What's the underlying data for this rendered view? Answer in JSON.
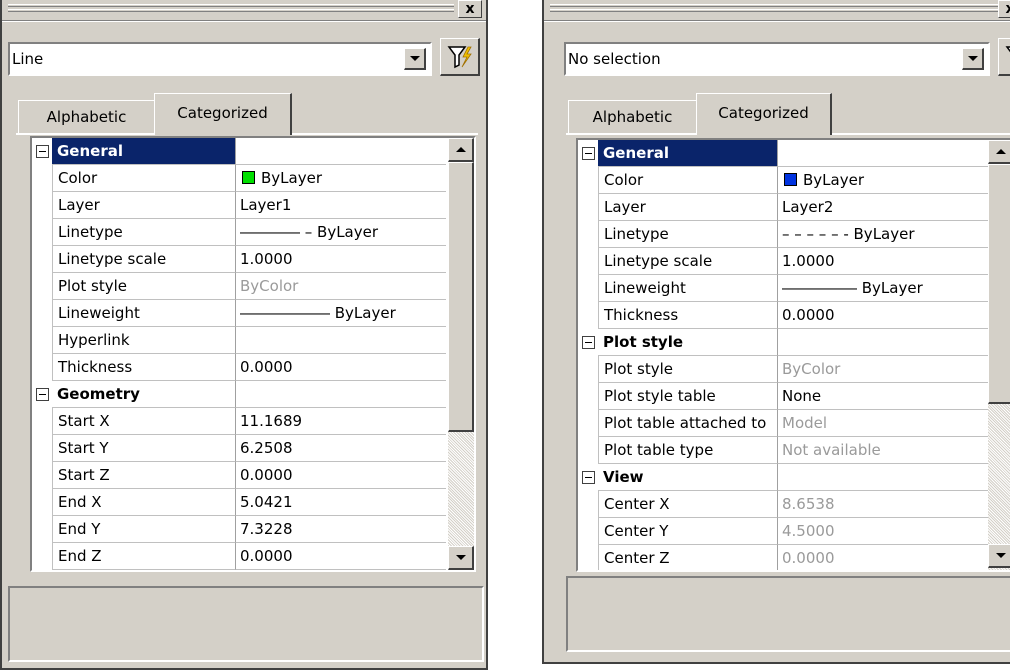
{
  "left_panel": {
    "close_glyph": "x",
    "selection_value": "Line",
    "tabs": {
      "alphabetic": "Alphabetic",
      "categorized": "Categorized"
    },
    "rows": [
      {
        "name": "General",
        "value": "",
        "category": true,
        "selected": true
      },
      {
        "name": "Color",
        "value": "ByLayer",
        "swatch": "#00e000"
      },
      {
        "name": "Layer",
        "value": "Layer1"
      },
      {
        "name": "Linetype",
        "value": "―――― –   ByLayer"
      },
      {
        "name": "Linetype scale",
        "value": "1.0000"
      },
      {
        "name": "Plot style",
        "value": "ByColor",
        "gray": true
      },
      {
        "name": "Lineweight",
        "value": "―――――― ByLayer"
      },
      {
        "name": "Hyperlink",
        "value": ""
      },
      {
        "name": "Thickness",
        "value": "0.0000"
      },
      {
        "name": "Geometry",
        "value": "",
        "category": true
      },
      {
        "name": "Start X",
        "value": "11.1689"
      },
      {
        "name": "Start Y",
        "value": "6.2508"
      },
      {
        "name": "Start Z",
        "value": "0.0000"
      },
      {
        "name": "End X",
        "value": "5.0421"
      },
      {
        "name": "End Y",
        "value": "7.3228"
      },
      {
        "name": "End Z",
        "value": "0.0000"
      }
    ]
  },
  "right_panel": {
    "close_glyph": "x",
    "selection_value": "No selection",
    "tabs": {
      "alphabetic": "Alphabetic",
      "categorized": "Categorized"
    },
    "rows": [
      {
        "name": "General",
        "value": "",
        "category": true,
        "selected": true
      },
      {
        "name": "Color",
        "value": "ByLayer",
        "swatch": "#0033e0"
      },
      {
        "name": "Layer",
        "value": "Layer2"
      },
      {
        "name": "Linetype",
        "value": "– – – – – - ByLayer"
      },
      {
        "name": "Linetype scale",
        "value": "1.0000"
      },
      {
        "name": "Lineweight",
        "value": "――――― ByLayer"
      },
      {
        "name": "Thickness",
        "value": "0.0000"
      },
      {
        "name": "Plot style",
        "value": "",
        "category": true
      },
      {
        "name": "Plot style",
        "value": "ByColor",
        "gray": true
      },
      {
        "name": "Plot style table",
        "value": "None"
      },
      {
        "name": "Plot table attached to",
        "value": "Model",
        "gray": true
      },
      {
        "name": "Plot table type",
        "value": "Not available",
        "gray": true
      },
      {
        "name": "View",
        "value": "",
        "category": true
      },
      {
        "name": "Center X",
        "value": "8.6538",
        "gray": true
      },
      {
        "name": "Center Y",
        "value": "4.5000",
        "gray": true
      },
      {
        "name": "Center Z",
        "value": "0.0000",
        "gray": true
      }
    ]
  }
}
